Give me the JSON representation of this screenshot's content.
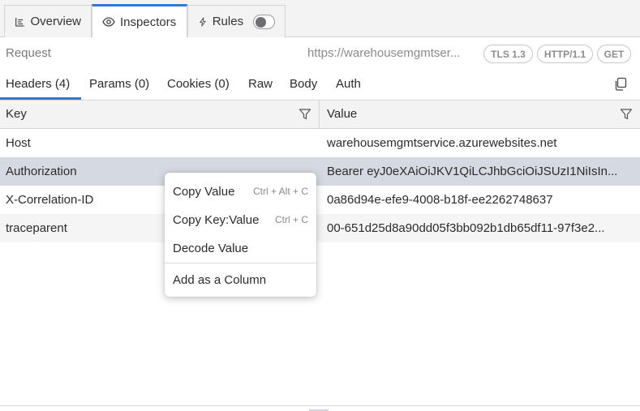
{
  "top_tabs": [
    {
      "label": "Overview",
      "icon": "list-icon"
    },
    {
      "label": "Inspectors",
      "icon": "eye-icon",
      "active": true
    },
    {
      "label": "Rules",
      "icon": "lightning-icon",
      "toggle": false
    }
  ],
  "request": {
    "label": "Request",
    "url": "https://warehousemgmtser...",
    "pills": [
      "TLS 1.3",
      "HTTP/1.1",
      "GET"
    ]
  },
  "sub_tabs": [
    "Headers (4)",
    "Params (0)",
    "Cookies (0)",
    "Raw",
    "Body",
    "Auth"
  ],
  "table": {
    "columns": [
      "Key",
      "Value"
    ],
    "rows": [
      {
        "key": "Host",
        "value": "warehousemgmtservice.azurewebsites.net"
      },
      {
        "key": "Authorization",
        "value": "Bearer eyJ0eXAiOiJKV1QiLCJhbGciOiJSUzI1NiIsIn..."
      },
      {
        "key": "X-Correlation-ID",
        "value": "0a86d94e-efe9-4008-b18f-ee2262748637"
      },
      {
        "key": "traceparent",
        "value": "00-651d25d8a90dd05f3bb092b1db65df11-97f3e2..."
      }
    ]
  },
  "context_menu": {
    "items": [
      {
        "label": "Copy Value",
        "shortcut": "Ctrl + Alt + C"
      },
      {
        "label": "Copy Key:Value",
        "shortcut": "Ctrl + C"
      },
      {
        "label": "Decode Value",
        "shortcut": ""
      },
      {
        "label": "Add as a Column",
        "shortcut": ""
      }
    ]
  },
  "colors": {
    "accent": "#2f7ad6",
    "selected_row": "#d5d9e2"
  }
}
